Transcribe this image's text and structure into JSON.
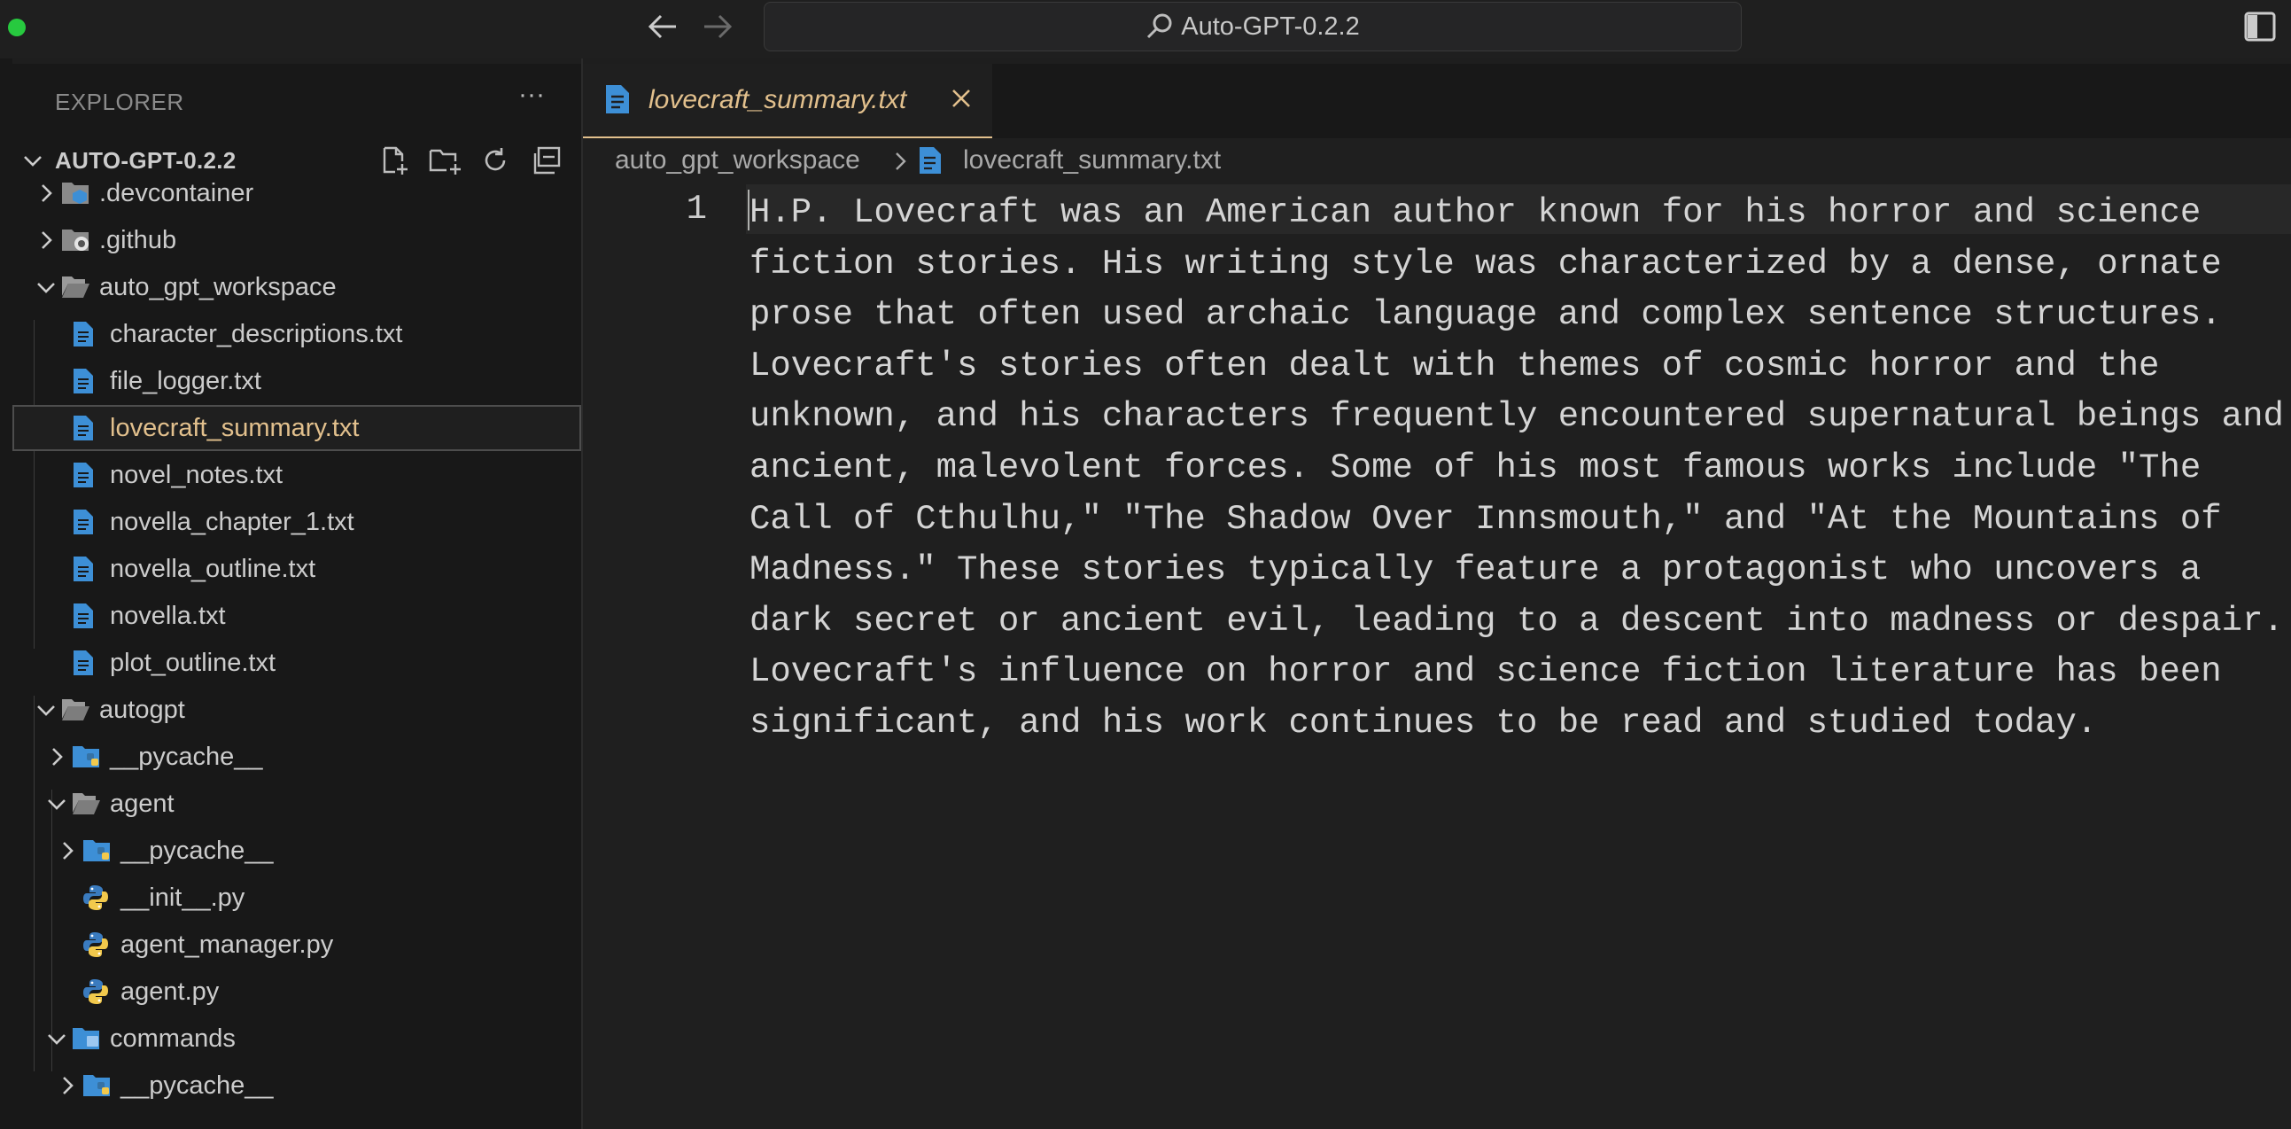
{
  "window": {
    "command_center_text": "Auto-GPT-0.2.2"
  },
  "sidebar": {
    "title": "EXPLORER",
    "more_label": "···",
    "root_label": "AUTO-GPT-0.2.2",
    "tree": [
      {
        "label": ".devcontainer",
        "kind": "folder",
        "icon": "devcontainer-folder-icon",
        "expanded": false
      },
      {
        "label": ".github",
        "kind": "folder",
        "icon": "github-folder-icon",
        "expanded": false
      },
      {
        "label": "auto_gpt_workspace",
        "kind": "folder",
        "icon": "folder-open-icon",
        "expanded": true
      },
      {
        "label": "character_descriptions.txt",
        "kind": "file",
        "icon": "text-file-icon"
      },
      {
        "label": "file_logger.txt",
        "kind": "file",
        "icon": "text-file-icon"
      },
      {
        "label": "lovecraft_summary.txt",
        "kind": "file",
        "icon": "text-file-icon",
        "selected": true
      },
      {
        "label": "novel_notes.txt",
        "kind": "file",
        "icon": "text-file-icon"
      },
      {
        "label": "novella_chapter_1.txt",
        "kind": "file",
        "icon": "text-file-icon"
      },
      {
        "label": "novella_outline.txt",
        "kind": "file",
        "icon": "text-file-icon"
      },
      {
        "label": "novella.txt",
        "kind": "file",
        "icon": "text-file-icon"
      },
      {
        "label": "plot_outline.txt",
        "kind": "file",
        "icon": "text-file-icon"
      },
      {
        "label": "autogpt",
        "kind": "folder",
        "icon": "folder-open-icon",
        "expanded": true
      },
      {
        "label": "__pycache__",
        "kind": "folder",
        "icon": "python-folder-icon",
        "expanded": false
      },
      {
        "label": "agent",
        "kind": "folder",
        "icon": "folder-open-icon",
        "expanded": true
      },
      {
        "label": "__pycache__",
        "kind": "folder",
        "icon": "python-folder-icon",
        "expanded": false
      },
      {
        "label": "__init__.py",
        "kind": "file",
        "icon": "python-file-icon"
      },
      {
        "label": "agent_manager.py",
        "kind": "file",
        "icon": "python-file-icon"
      },
      {
        "label": "agent.py",
        "kind": "file",
        "icon": "python-file-icon"
      },
      {
        "label": "commands",
        "kind": "folder",
        "icon": "commands-folder-icon",
        "expanded": true
      },
      {
        "label": "__pycache__",
        "kind": "folder",
        "icon": "python-folder-icon",
        "expanded": false
      }
    ]
  },
  "editor": {
    "tab_label": "lovecraft_summary.txt",
    "breadcrumb": [
      "auto_gpt_workspace",
      "lovecraft_summary.txt"
    ],
    "line_number": "1",
    "content": "H.P. Lovecraft was an American author known for his horror and science fiction stories. His writing style was characterized by a dense, ornate prose that often used archaic language and complex sentence structures. Lovecraft's stories often dealt with themes of cosmic horror and the unknown, and his characters frequently encountered supernatural beings and ancient, malevolent forces. Some of his most famous works include \"The Call of Cthulhu,\" \"The Shadow Over Innsmouth,\" and \"At the Mountains of Madness.\" These stories typically feature a protagonist who uncovers a dark secret or ancient evil, leading to a descent into madness or despair. Lovecraft's influence on horror and science fiction literature has been significant, and his work continues to be read and studied today."
  },
  "colors": {
    "selected_text": "#e2c08d",
    "file_icon": "#3d8fd6",
    "folder_icon": "#8a8a8a"
  }
}
